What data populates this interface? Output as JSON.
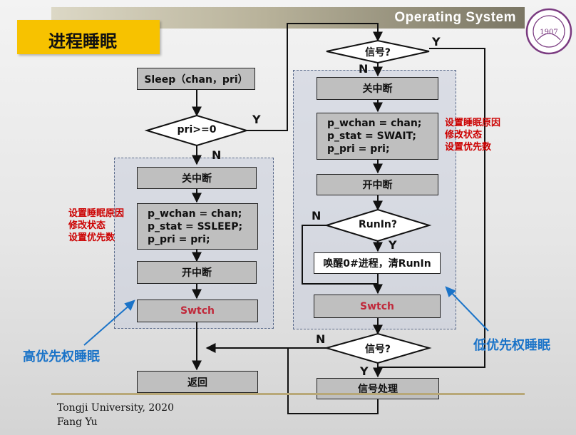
{
  "header": {
    "course_title": "Operating  System"
  },
  "slide": {
    "title": "进程睡眠"
  },
  "left_flow": {
    "start": "Sleep（chan，pri）",
    "decision": "pri>=0",
    "yes": "Y",
    "no": "N",
    "steps": {
      "disable_int": "关中断",
      "set_fields": [
        "p_wchan = chan;",
        "p_stat = SSLEEP;",
        "p_pri = pri;"
      ],
      "enable_int": "开中断",
      "switch": "Swtch",
      "return": "返回"
    },
    "notes": [
      "设置睡眠原因",
      "修改状态",
      "设置优先数"
    ],
    "label": "高优先权睡眠"
  },
  "right_flow": {
    "signal_decision": "信号?",
    "yes": "Y",
    "no": "N",
    "steps": {
      "disable_int": "关中断",
      "set_fields": [
        "p_wchan = chan;",
        "p_stat = SWAIT;",
        "p_pri = pri;"
      ],
      "enable_int": "开中断",
      "runin_decision": "RunIn?",
      "runin_yes": "Y",
      "runin_no": "N",
      "wake": "唤醒0#进程，清RunIn",
      "switch": "Swtch",
      "signal_decision2": "信号?",
      "signal2_no": "N",
      "signal2_yes": "Y",
      "handle": "信号处理"
    },
    "notes": [
      "设置睡眠原因",
      "修改状态",
      "设置优先数"
    ],
    "label": "低优先权睡眠"
  },
  "footer": {
    "line1": "Tongji University,  2020",
    "line2": "Fang Yu"
  },
  "colors": {
    "accent": "#f7c200",
    "box": "#bfbfbf",
    "note": "#cc0000",
    "label": "#1a73c8"
  }
}
